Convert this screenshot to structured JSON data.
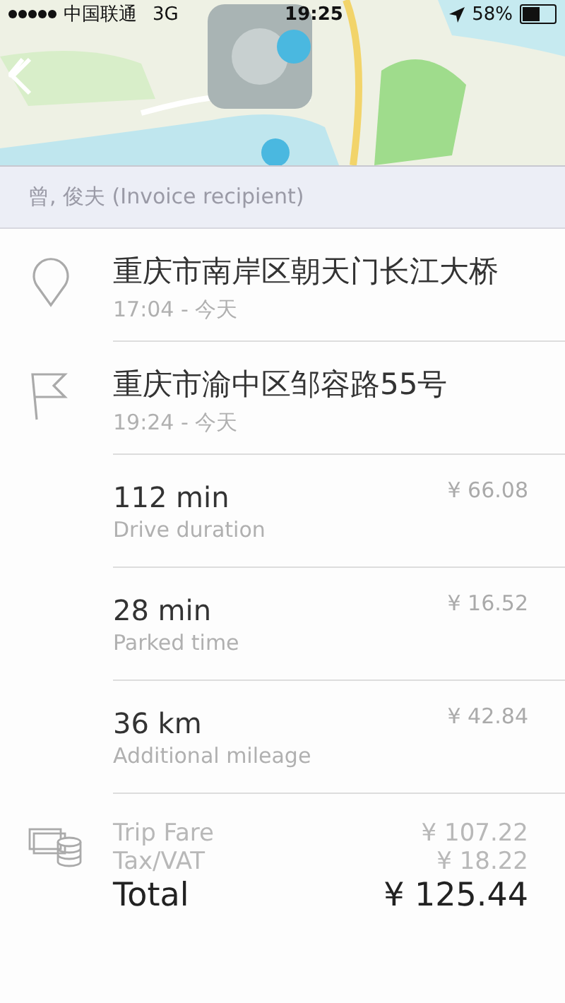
{
  "status_bar": {
    "carrier": "中国联通",
    "network": "3G",
    "time": "19:25",
    "battery": "58%"
  },
  "recipient": "曾, 俊夫 (Invoice recipient)",
  "stops": [
    {
      "kind": "start",
      "address": "重庆市南岸区朝天门长江大桥",
      "time": "17:04 - 今天"
    },
    {
      "kind": "end",
      "address": "重庆市渝中区邹容路55号",
      "time": "19:24 - 今天"
    }
  ],
  "items": [
    {
      "value": "112 min",
      "label": "Drive duration",
      "price": "¥ 66.08"
    },
    {
      "value": "28 min",
      "label": "Parked time",
      "price": "¥ 16.52"
    },
    {
      "value": "36 km",
      "label": "Additional mileage",
      "price": "¥ 42.84"
    }
  ],
  "summary": [
    {
      "kind": "sub",
      "label": "Trip Fare",
      "amount": "¥ 107.22"
    },
    {
      "kind": "sub",
      "label": "Tax/VAT",
      "amount": "¥ 18.22"
    },
    {
      "kind": "total",
      "label": "Total",
      "amount": "¥ 125.44"
    }
  ]
}
